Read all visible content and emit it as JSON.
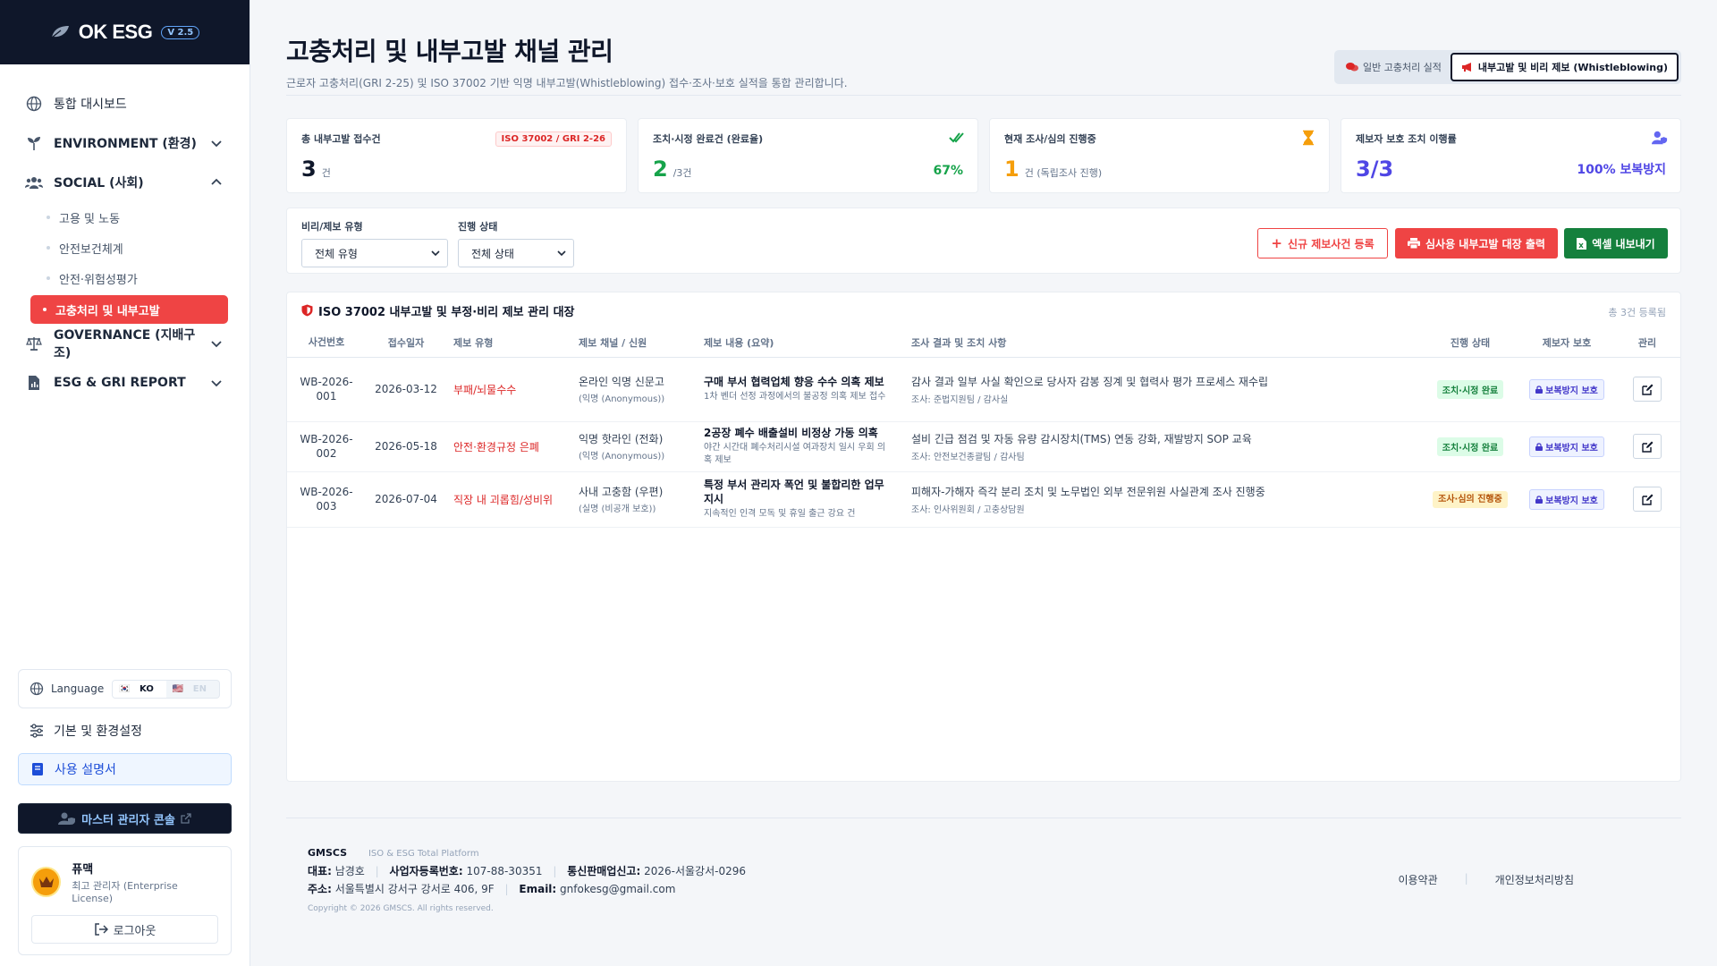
{
  "brand": {
    "name": "OK ESG",
    "version": "V 2.5"
  },
  "nav": {
    "dashboard": "통합 대시보드",
    "environment": "ENVIRONMENT (환경)",
    "social": "SOCIAL (사회)",
    "social_items": [
      "고용 및 노동",
      "안전보건체계",
      "안전·위험성평가",
      "고충처리 및 내부고발"
    ],
    "governance": "GOVERNANCE (지배구조)",
    "report": "ESG & GRI REPORT"
  },
  "sidebar_bottom": {
    "language_label": "Language",
    "lang_ko": "KO",
    "lang_en": "EN",
    "settings": "기본 및 환경설정",
    "manual": "사용 설명서",
    "master": "마스터 관리자 콘솔",
    "user_name": "퓨맥",
    "user_role": "최고 관리자 (Enterprise License)",
    "logout": "로그아웃"
  },
  "page": {
    "title": "고충처리 및 내부고발 채널 관리",
    "subtitle": "근로자 고충처리(GRI 2-25) 및 ISO 37002 기반 익명 내부고발(Whistleblowing) 접수·조사·보호 실적을 통합 관리합니다.",
    "tab_general": "일반 고충처리 실적",
    "tab_whistle": "내부고발 및 비리 제보 (Whistleblowing)"
  },
  "kpis": {
    "total": {
      "label": "총 내부고발 접수건",
      "tag": "ISO 37002 / GRI 2-26",
      "value": "3",
      "unit": "건"
    },
    "done": {
      "label": "조치·시정 완료건 (완료율)",
      "value": "2",
      "unit": "/3건",
      "pct": "67%"
    },
    "progress": {
      "label": "현재 조사/심의 진행중",
      "value": "1",
      "unit": "건 (독립조사 진행)"
    },
    "protect": {
      "label": "제보자 보호 조치 이행률",
      "value": "3/3",
      "pct": "100% 보복방지"
    }
  },
  "filters": {
    "type_label": "비리/제보 유형",
    "type_value": "전체 유형",
    "status_label": "진행 상태",
    "status_value": "전체 상태",
    "btn_new": "신규 제보사건 등록",
    "btn_print": "심사용 내부고발 대장 출력",
    "btn_excel": "엑셀 내보내기"
  },
  "ledger": {
    "title": "ISO 37002 내부고발 및 부정·비리 제보 관리 대장",
    "count": "총 3건 등록됨",
    "columns": [
      "사건번호",
      "접수일자",
      "제보 유형",
      "제보 채널 / 신원",
      "제보 내용 (요약)",
      "조사 결과 및 조치 사항",
      "진행 상태",
      "제보자 보호",
      "관리"
    ],
    "rows": [
      {
        "id": "WB-2026-001",
        "date": "2026-03-12",
        "type": "부패/뇌물수수",
        "channel": "온라인 익명 신문고",
        "identity": "(익명 (Anonymous))",
        "summary": "구매 부서 협력업체 향응 수수 의혹 제보",
        "summary_detail": "1차 벤더 선정 과정에서의 불공정 의혹 제보 접수",
        "result": "감사 결과 일부 사실 확인으로 당사자 감봉 징계 및 협력사 평가 프로세스 재수립",
        "investigator": "조사: 준법지원팀 / 감사실",
        "status": "조치·시정 완료",
        "status_kind": "done",
        "protection": "보복방지 보호"
      },
      {
        "id": "WB-2026-002",
        "date": "2026-05-18",
        "type": "안전·환경규정 은폐",
        "channel": "익명 핫라인 (전화)",
        "identity": "(익명 (Anonymous))",
        "summary": "2공장 폐수 배출설비 비정상 가동 의혹",
        "summary_detail": "야간 시간대 폐수처리시설 여과장치 일시 우회 의혹 제보",
        "result": "설비 긴급 점검 및 자동 유량 감시장치(TMS) 연동 강화, 재발방지 SOP 교육",
        "investigator": "조사: 안전보건종괄팀 / 감사팀",
        "status": "조치·시정 완료",
        "status_kind": "done",
        "protection": "보복방지 보호"
      },
      {
        "id": "WB-2026-003",
        "date": "2026-07-04",
        "type": "직장 내 괴롭힘/성비위",
        "channel": "사내 고충함 (우편)",
        "identity": "(실명 (비공개 보호))",
        "summary": "특정 부서 관리자 폭언 및 불합리한 업무 지시",
        "summary_detail": "지속적인 인격 모독 및 휴일 출근 강요 건",
        "result": "피해자-가해자 즉각 분리 조치 및 노무법인 외부 전문위원 사실관계 조사 진행중",
        "investigator": "조사: 인사위원회 / 고충상담원",
        "status": "조사·심의 진행중",
        "status_kind": "prog",
        "protection": "보복방지 보호"
      }
    ]
  },
  "footer": {
    "company": "GMSCS",
    "platform": "ISO & ESG Total Platform",
    "rep_label": "대표:",
    "rep": "남경호",
    "biz_label": "사업자등록번호:",
    "biz": "107-88-30351",
    "sales_label": "통신판매업신고:",
    "sales": "2026-서울강서-0296",
    "addr_label": "주소:",
    "addr": "서울특별시 강서구 강서로 406, 9F",
    "email_label": "Email:",
    "email": "gnfokesg@gmail.com",
    "copyright": "Copyright © 2026 GMSCS. All rights reserved.",
    "terms": "이용약관",
    "privacy": "개인정보처리방침"
  },
  "colors": {
    "accent_red": "#ef4444",
    "navy": "#0f172a",
    "green": "#15803d",
    "indigo": "#4f46e5",
    "amber": "#f59e0b"
  }
}
